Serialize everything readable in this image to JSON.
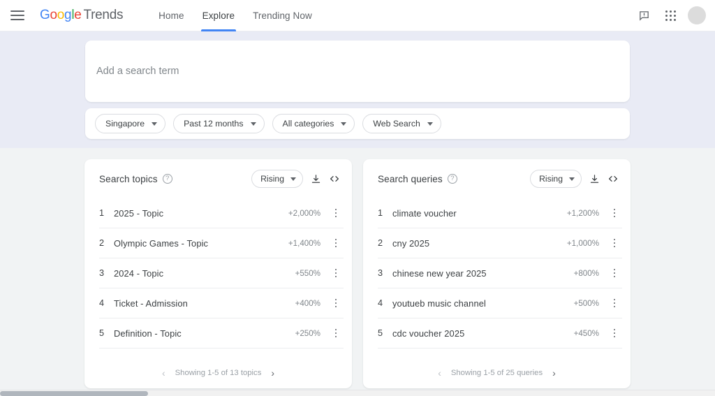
{
  "header": {
    "menu_icon": "hamburger-menu-icon",
    "brand": {
      "google": "Google",
      "trends": "Trends"
    },
    "nav": [
      {
        "label": "Home",
        "active": false
      },
      {
        "label": "Explore",
        "active": true
      },
      {
        "label": "Trending Now",
        "active": false
      }
    ],
    "feedback_icon": "feedback-icon",
    "apps_icon": "apps-grid-icon",
    "avatar": "user-avatar"
  },
  "search": {
    "placeholder": "Add a search term",
    "value": ""
  },
  "filters": [
    {
      "label": "Singapore",
      "name": "location-filter"
    },
    {
      "label": "Past 12 months",
      "name": "time-range-filter"
    },
    {
      "label": "All categories",
      "name": "category-filter"
    },
    {
      "label": "Web Search",
      "name": "search-type-filter"
    }
  ],
  "panels": [
    {
      "title": "Search topics",
      "help_icon": "help-icon",
      "sort": "Rising",
      "download_icon": "download-icon",
      "embed_icon": "embed-code-icon",
      "rows": [
        {
          "rank": "1",
          "label": "2025 - Topic",
          "value": "+2,000%"
        },
        {
          "rank": "2",
          "label": "Olympic Games - Topic",
          "value": "+1,400%"
        },
        {
          "rank": "3",
          "label": "2024 - Topic",
          "value": "+550%"
        },
        {
          "rank": "4",
          "label": "Ticket - Admission",
          "value": "+400%"
        },
        {
          "rank": "5",
          "label": "Definition - Topic",
          "value": "+250%"
        }
      ],
      "pager": {
        "prev": "‹",
        "text": "Showing 1-5 of 13 topics",
        "next": "›"
      }
    },
    {
      "title": "Search queries",
      "help_icon": "help-icon",
      "sort": "Rising",
      "download_icon": "download-icon",
      "embed_icon": "embed-code-icon",
      "rows": [
        {
          "rank": "1",
          "label": "climate voucher",
          "value": "+1,200%"
        },
        {
          "rank": "2",
          "label": "cny 2025",
          "value": "+1,000%"
        },
        {
          "rank": "3",
          "label": "chinese new year 2025",
          "value": "+800%"
        },
        {
          "rank": "4",
          "label": "youtueb music channel",
          "value": "+500%"
        },
        {
          "rank": "5",
          "label": "cdc voucher 2025",
          "value": "+450%"
        }
      ],
      "pager": {
        "prev": "‹",
        "text": "Showing 1-5 of 25 queries",
        "next": "›"
      }
    }
  ],
  "colors": {
    "accent": "#4285F4",
    "google_blue": "#4285F4",
    "google_red": "#EA4335",
    "google_yellow": "#FBBC05",
    "google_green": "#34A853",
    "upper_bg": "#e9ebf5",
    "lower_bg": "#f1f3f4",
    "card_bg": "#ffffff",
    "text_primary": "#3c4043",
    "text_secondary": "#80868b"
  }
}
